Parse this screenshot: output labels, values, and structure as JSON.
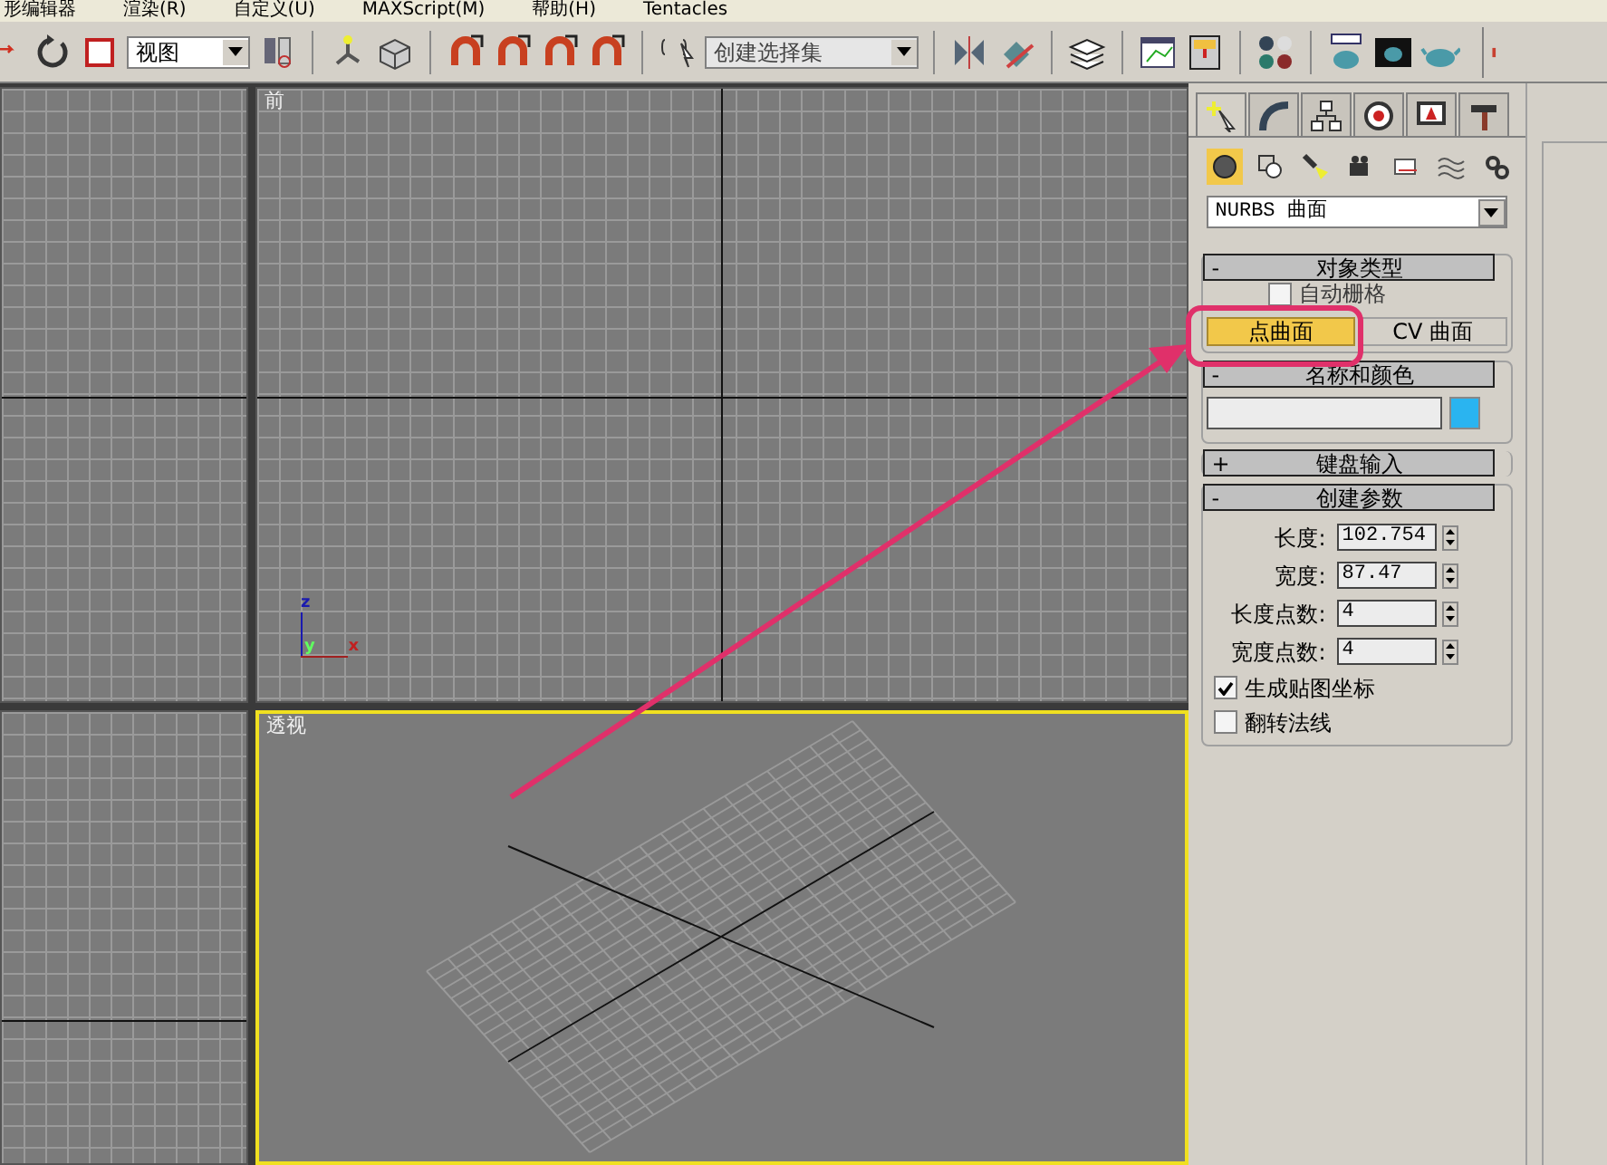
{
  "menu_bar": [
    "形编辑器",
    "渲染(R)",
    "自定义(U)",
    "MAXScript(M)",
    "帮助(H)",
    "Tentacles"
  ],
  "toolbar": {
    "view_dropdown": "视图",
    "selection_set": {
      "placeholder": "创建选择集"
    }
  },
  "viewports": [
    {
      "active": false,
      "kind": "grid"
    },
    {
      "label": "前",
      "active": false,
      "kind": "front"
    },
    {
      "active": false,
      "kind": "grid"
    },
    {
      "label": "透视",
      "active": true,
      "kind": "perspective"
    }
  ],
  "axis_labels": [
    "z",
    "y",
    "x"
  ],
  "command_panel": {
    "tabs": [
      {
        "kind": "create",
        "selected": true
      },
      {
        "kind": "modify",
        "selected": false
      },
      {
        "kind": "hierarchy",
        "selected": false
      },
      {
        "kind": "motion",
        "selected": false
      },
      {
        "kind": "display",
        "selected": false
      },
      {
        "kind": "utilities",
        "selected": false
      }
    ],
    "categories": [
      {
        "kind": "geometry",
        "selected": true
      },
      {
        "kind": "shapes",
        "selected": false
      },
      {
        "kind": "lights",
        "selected": false
      },
      {
        "kind": "cameras",
        "selected": false
      },
      {
        "kind": "helpers",
        "selected": false
      },
      {
        "kind": "spacewarps",
        "selected": false
      },
      {
        "kind": "systems",
        "selected": false
      }
    ],
    "type_dropdown": "NURBS 曲面",
    "rollouts": [
      {
        "kind": "object_type",
        "title": "对象类型",
        "sign": "-",
        "expanded": true,
        "autogrid": {
          "label": "自动栅格",
          "checked": false,
          "disabled": true
        },
        "buttons": [
          {
            "label": "点曲面",
            "selected": true
          },
          {
            "label": "CV 曲面",
            "selected": false
          }
        ]
      },
      {
        "kind": "name_color",
        "title": "名称和颜色",
        "sign": "-",
        "expanded": true,
        "color": "#2ab4f0"
      },
      {
        "kind": "keyboard",
        "title": "键盘输入",
        "sign": "+",
        "expanded": false
      },
      {
        "kind": "params",
        "title": "创建参数",
        "sign": "-",
        "expanded": true,
        "fields": [
          {
            "label": "长度:",
            "value": "102.754"
          },
          {
            "label": "宽度:",
            "value": "87.47"
          },
          {
            "label": "长度点数:",
            "value": "4"
          },
          {
            "label": "宽度点数:",
            "value": "4"
          }
        ],
        "checkboxes": [
          {
            "label": "生成贴图坐标",
            "checked": true
          },
          {
            "label": "翻转法线",
            "checked": false
          }
        ]
      }
    ]
  }
}
